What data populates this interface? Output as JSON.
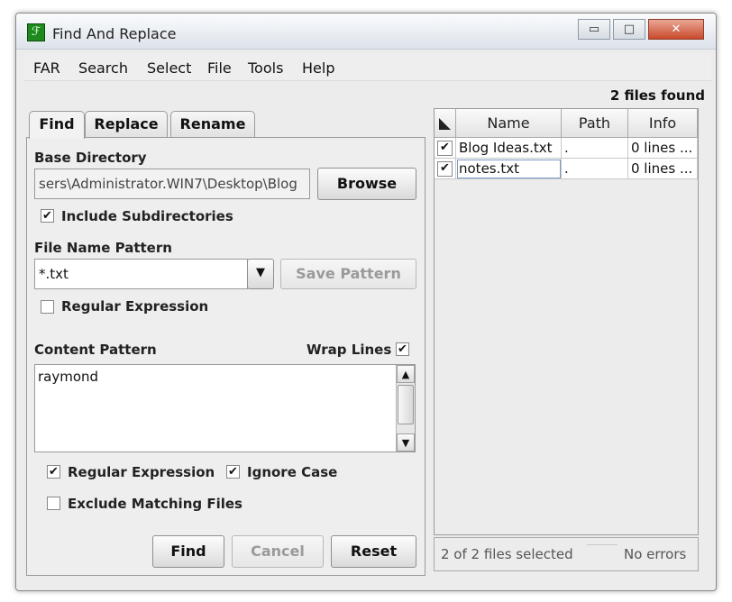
{
  "window": {
    "title": "Find And Replace",
    "minimize": "▭",
    "maximize": "□",
    "close": "✕",
    "icon": "far-app-icon"
  },
  "menu": [
    "FAR",
    "Search",
    "Select",
    "File",
    "Tools",
    "Help"
  ],
  "status_top": "2 files found",
  "tabs": [
    "Find",
    "Replace",
    "Rename"
  ],
  "find": {
    "base_directory_label": "Base Directory",
    "base_directory_value": "sers\\Administrator.WIN7\\Desktop\\Blog",
    "browse_label": "Browse",
    "include_subdirs_label": "Include Subdirectories",
    "include_subdirs_checked": "✔",
    "file_name_pattern_label": "File Name Pattern",
    "file_name_pattern_value": "*.txt",
    "save_pattern_label": "Save Pattern",
    "fn_regex_label": "Regular Expression",
    "fn_regex_checked": "",
    "content_pattern_label": "Content Pattern",
    "wrap_lines_label": "Wrap Lines",
    "wrap_lines_checked": "✔",
    "content_value": "raymond",
    "cp_regex_label": "Regular Expression",
    "cp_regex_checked": "✔",
    "ignore_case_label": "Ignore Case",
    "ignore_case_checked": "✔",
    "exclude_label": "Exclude Matching Files",
    "exclude_checked": "",
    "find_button": "Find",
    "cancel_button": "Cancel",
    "reset_button": "Reset"
  },
  "results": {
    "columns": [
      "Name",
      "Path",
      "Info"
    ],
    "rows": [
      {
        "checked": "✔",
        "name": "Blog Ideas.txt",
        "path": ".",
        "info": "0 lines ..."
      },
      {
        "checked": "✔",
        "name": "notes.txt",
        "path": ".",
        "info": "0 lines ..."
      }
    ],
    "selected_status": "2 of 2 files selected",
    "error_status": "No errors"
  }
}
